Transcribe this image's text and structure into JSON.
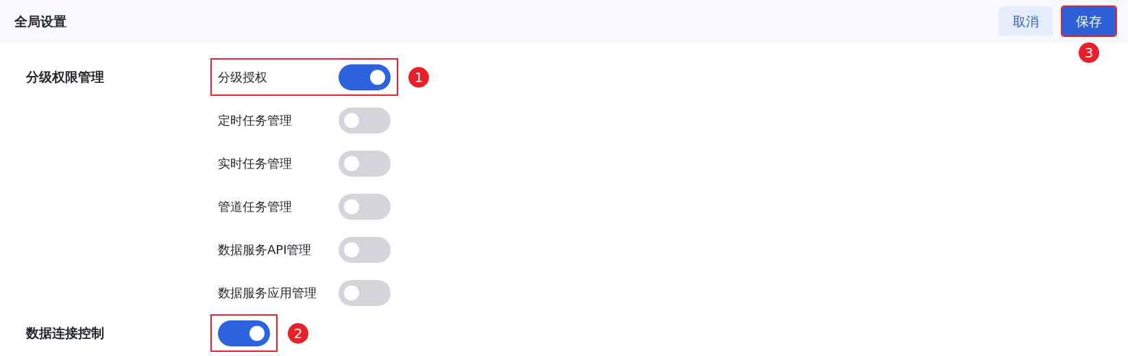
{
  "header": {
    "title": "全局设置",
    "buttons": [
      {
        "label": "取消",
        "kind": "secondary",
        "highlighted": false
      },
      {
        "label": "保存",
        "kind": "primary",
        "highlighted": true,
        "callout": "3"
      }
    ]
  },
  "sections": [
    {
      "title": "分级权限管理",
      "items": [
        {
          "label": "分级授权",
          "on": true,
          "highlighted": true,
          "callout": "1"
        },
        {
          "label": "定时任务管理",
          "on": false,
          "highlighted": false
        },
        {
          "label": "实时任务管理",
          "on": false,
          "highlighted": false
        },
        {
          "label": "管道任务管理",
          "on": false,
          "highlighted": false
        },
        {
          "label": "数据服务API管理",
          "on": false,
          "highlighted": false
        },
        {
          "label": "数据服务应用管理",
          "on": false,
          "highlighted": false
        }
      ]
    },
    {
      "title": "数据连接控制",
      "items": [
        {
          "on": true,
          "highlighted": true,
          "callout": "2"
        }
      ]
    }
  ]
}
